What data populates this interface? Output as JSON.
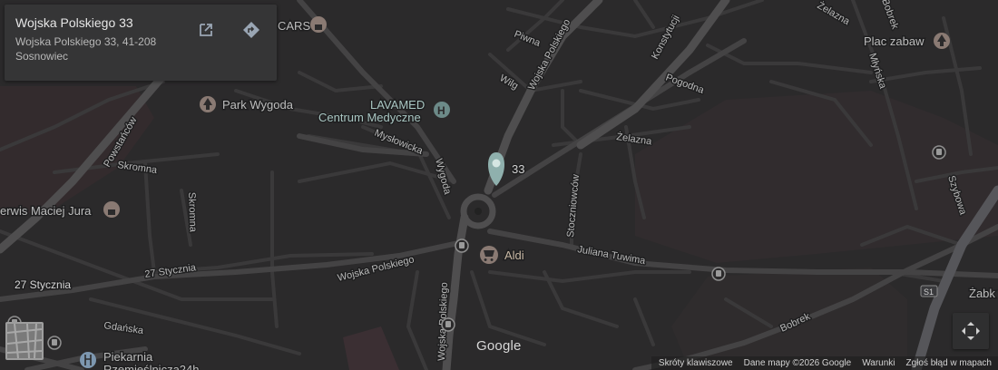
{
  "info_card": {
    "title": "Wojska Polskiego 33",
    "address_line1": "Wojska Polskiego 33, 41-208",
    "address_line2": "Sosnowiec"
  },
  "map": {
    "streets": [
      "Piwna",
      "Wojska Polskiego",
      "Konstytucji",
      "Wilg",
      "Pogodna",
      "Powstańców",
      "Mysłowicka",
      "Wygoda",
      "Żelazna",
      "Skromna",
      "Stoczniowców",
      "Juliana Tuwima",
      "27 Stycznia",
      "Gdańska",
      "Bobrek",
      "Szybowa",
      "Młyńska",
      "Żelazna",
      "Wojska Polskiego",
      "Wojska Polskiego"
    ],
    "pois": {
      "park": "Park Wygoda",
      "medical_line1": "LAVAMED",
      "medical_line2": "Centrum Medyczne",
      "shop": "Aldi",
      "service": "erwis Maciej Jura",
      "bakery_line1": "Piekarnia",
      "bakery_line2": "Rzemieślnicza24h",
      "cars": "CARS",
      "playground": "Plac zabaw",
      "zabk": "Żabk",
      "road27": "27 Stycznia"
    },
    "pin_label": "33",
    "route_shield": "S1"
  },
  "logo": "Google",
  "attribution": {
    "shortcuts": "Skróty klawiszowe",
    "data": "Dane mapy ©2026 Google",
    "terms": "Warunki",
    "report": "Zgłoś błąd w mapach"
  },
  "colors": {
    "background": "#2b2a2b",
    "road": "#3f3f40",
    "main_road": "#4f4f50",
    "pin": "#8fb0ad"
  }
}
